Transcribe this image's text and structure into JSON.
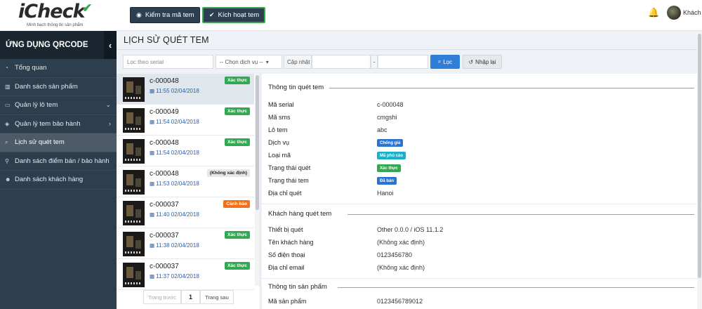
{
  "brand": {
    "name": "iCheck",
    "check_icon": "checkmark",
    "slogan": "Minh bạch thông tin sản phẩm"
  },
  "header": {
    "check_button": "Kiểm tra mã tem",
    "activate_button": "Kích hoạt tem",
    "user_name": "Khách"
  },
  "sidebar": {
    "title": "ỨNG DỤNG QRCODE",
    "items": [
      {
        "label": "Tổng quan",
        "icon": "dashboard-icon",
        "chevron": ""
      },
      {
        "label": "Danh sách sản phẩm",
        "icon": "barcode-icon",
        "chevron": ""
      },
      {
        "label": "Quản lý lô tem",
        "icon": "folder-icon",
        "chevron": "⌄"
      },
      {
        "label": "Quản lý tem bảo hành",
        "icon": "shield-icon",
        "chevron": "›"
      },
      {
        "label": "Lịch sử quét tem",
        "icon": "search-icon",
        "chevron": "",
        "active": true
      },
      {
        "label": "Danh sách điểm bán / bảo hành",
        "icon": "map-marker-icon",
        "chevron": ""
      },
      {
        "label": "Danh sách khách hàng",
        "icon": "users-icon",
        "chevron": ""
      }
    ]
  },
  "main": {
    "title": "LỊCH SỬ QUÉT TEM",
    "filters": {
      "serial_placeholder": "Lọc theo serial",
      "service_select": "-- Chọn dịch vụ --",
      "update_label": "Cập nhật",
      "range_separator": "-",
      "filter_button": "Lọc",
      "reset_button": "Nhập lại"
    },
    "scans": [
      {
        "serial": "c-000048",
        "time": "11:55 02/04/2018",
        "status": "Xác thực",
        "status_color": "green",
        "selected": true
      },
      {
        "serial": "c-000049",
        "time": "11:54 02/04/2018",
        "status": "Xác thực",
        "status_color": "green"
      },
      {
        "serial": "c-000048",
        "time": "11:54 02/04/2018",
        "status": "Xác thực",
        "status_color": "green"
      },
      {
        "serial": "c-000048",
        "time": "11:53 02/04/2018",
        "status": "(Không xác định)",
        "status_color": "gray"
      },
      {
        "serial": "c-000037",
        "time": "11:40 02/04/2018",
        "status": "Cảnh báo",
        "status_color": "orange"
      },
      {
        "serial": "c-000037",
        "time": "11:38 02/04/2018",
        "status": "Xác thực",
        "status_color": "green"
      },
      {
        "serial": "c-000037",
        "time": "11:37 02/04/2018",
        "status": "Xác thực",
        "status_color": "green"
      }
    ],
    "pagination": {
      "prev": "Trang trước",
      "current": "1",
      "next": "Trang sau"
    },
    "detail": {
      "scan_info": {
        "heading": "Thông tin quét tem",
        "serial_label": "Mã serial",
        "serial_value": "c-000048",
        "sms_label": "Mã sms",
        "sms_value": "cmgshi",
        "lot_label": "Lô tem",
        "lot_value": "abc",
        "service_label": "Dịch vụ",
        "service_value": "Chống giả",
        "code_type_label": "Loại mã",
        "code_type_value": "Mã phủ cào",
        "scan_status_label": "Trạng thái quét",
        "scan_status_value": "Xác thực",
        "tem_status_label": "Trạng thái tem",
        "tem_status_value": "Đã bán",
        "location_label": "Địa chỉ quét",
        "location_value": "Hanoi"
      },
      "customer_info": {
        "heading": "Khách hàng quét tem",
        "device_label": "Thiết bị quét",
        "device_value": "Other 0.0.0 / iOS 11.1.2",
        "name_label": "Tên khách hàng",
        "name_value": "(Không xác định)",
        "phone_label": "Số điện thoại",
        "phone_value": "0123456780",
        "email_label": "Địa chỉ email",
        "email_value": "(Không xác định)"
      },
      "product_info": {
        "heading": "Thông tin sản phẩm",
        "code_label": "Mã sản phẩm",
        "code_value": "0123456789012"
      }
    }
  }
}
